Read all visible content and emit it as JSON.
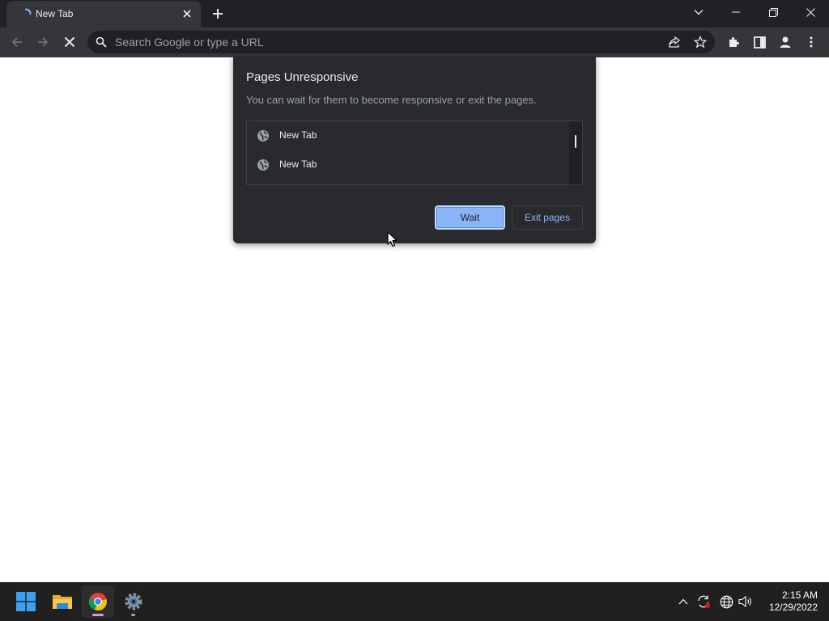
{
  "browser": {
    "tab": {
      "title": "New Tab"
    },
    "omnibox": {
      "placeholder": "Search Google or type a URL"
    }
  },
  "dialog": {
    "title": "Pages Unresponsive",
    "message": "You can wait for them to become responsive or exit the pages.",
    "pages": [
      {
        "title": "New Tab",
        "icon": "globe-icon"
      },
      {
        "title": "New Tab",
        "icon": "globe-icon"
      }
    ],
    "wait_label": "Wait",
    "exit_label": "Exit pages"
  },
  "taskbar": {
    "apps": [
      "windows-start",
      "file-explorer",
      "chrome",
      "settings"
    ],
    "clock": {
      "time": "2:15 AM",
      "date": "12/29/2022"
    }
  },
  "colors": {
    "accent": "#8ab4f8",
    "chrome_dark": "#202124",
    "toolbar": "#35363a",
    "dialog": "#292a2d",
    "taskbar": "#202020"
  }
}
